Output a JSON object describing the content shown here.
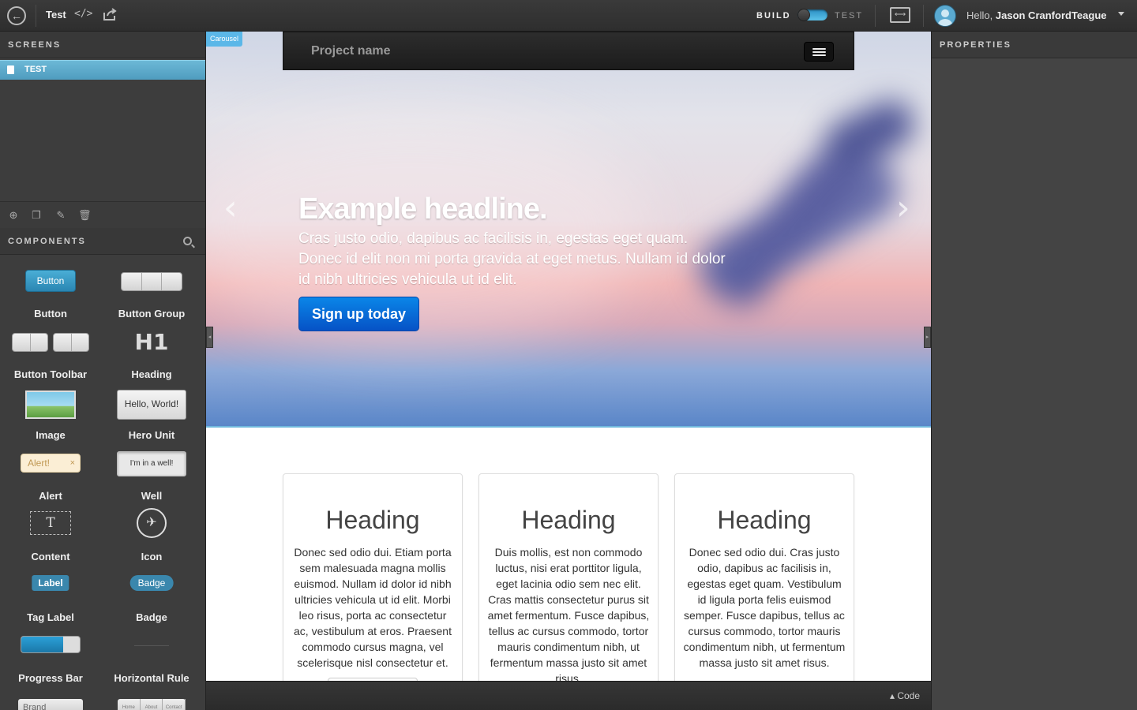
{
  "topbar": {
    "project_title": "Test",
    "code_glyph": "</>",
    "mode_build": "BUILD",
    "mode_test": "TEST",
    "greeting_prefix": "Hello,",
    "user_name": "Jason CranfordTeague"
  },
  "sidebar": {
    "screens_header": "SCREENS",
    "screens": [
      {
        "label": "TEST",
        "selected": true
      }
    ],
    "components_header": "COMPONENTS",
    "components": [
      {
        "label": "Button",
        "preview_text": "Button"
      },
      {
        "label": "Button Group"
      },
      {
        "label": "Button Toolbar"
      },
      {
        "label": "Heading",
        "preview_text": "H1"
      },
      {
        "label": "Image"
      },
      {
        "label": "Hero Unit",
        "preview_text": "Hello, World!"
      },
      {
        "label": "Alert",
        "preview_text": "Alert!"
      },
      {
        "label": "Well",
        "preview_text": "I'm in a well!"
      },
      {
        "label": "Content",
        "preview_text": "T"
      },
      {
        "label": "Icon"
      },
      {
        "label": "Tag Label",
        "preview_text": "Label"
      },
      {
        "label": "Badge",
        "preview_text": "Badge"
      },
      {
        "label": "Progress Bar",
        "progress": 0.72
      },
      {
        "label": "Horizontal Rule"
      },
      {
        "label": "",
        "preview_text": "Brand"
      },
      {
        "label": "",
        "preview_items": [
          "Home",
          "About",
          "Contact"
        ]
      }
    ]
  },
  "canvas": {
    "carousel_tag": "Carousel",
    "navbar_brand": "Project name",
    "hero": {
      "headline": "Example headline.",
      "lead": "Cras justo odio, dapibus ac facilisis in, egestas eget quam. Donec id elit non mi porta gravida at eget metus. Nullam id dolor id nibh ultricies vehicula ut id elit.",
      "cta": "Sign up today",
      "prev_glyph": "‹",
      "next_glyph": "›"
    },
    "cards": [
      {
        "heading": "Heading",
        "text": "Donec sed odio dui. Etiam porta sem malesuada magna mollis euismod. Nullam id dolor id nibh ultricies vehicula ut id elit. Morbi leo risus, porta ac consectetur ac, vestibulum at eros. Praesent commodo cursus magna, vel scelerisque nisl consectetur et."
      },
      {
        "heading": "Heading",
        "text": "Duis mollis, est non commodo luctus, nisi erat porttitor ligula, eget lacinia odio sem nec elit. Cras mattis consectetur purus sit amet fermentum. Fusce dapibus, tellus ac cursus commodo, tortor mauris condimentum nibh, ut fermentum massa justo sit amet risus."
      },
      {
        "heading": "Heading",
        "text": "Donec sed odio dui. Cras justo odio, dapibus ac facilisis in, egestas eget quam. Vestibulum id ligula porta felis euismod semper. Fusce dapibus, tellus ac cursus commodo, tortor mauris condimentum nibh, ut fermentum massa justo sit amet risus."
      }
    ]
  },
  "codebar": {
    "label": "Code",
    "glyph": "▴"
  },
  "properties": {
    "header": "PROPERTIES"
  },
  "colors": {
    "accent": "#5bb7e8",
    "cta": "#0a6fdc",
    "selected_screen": "#5ba9cc"
  }
}
